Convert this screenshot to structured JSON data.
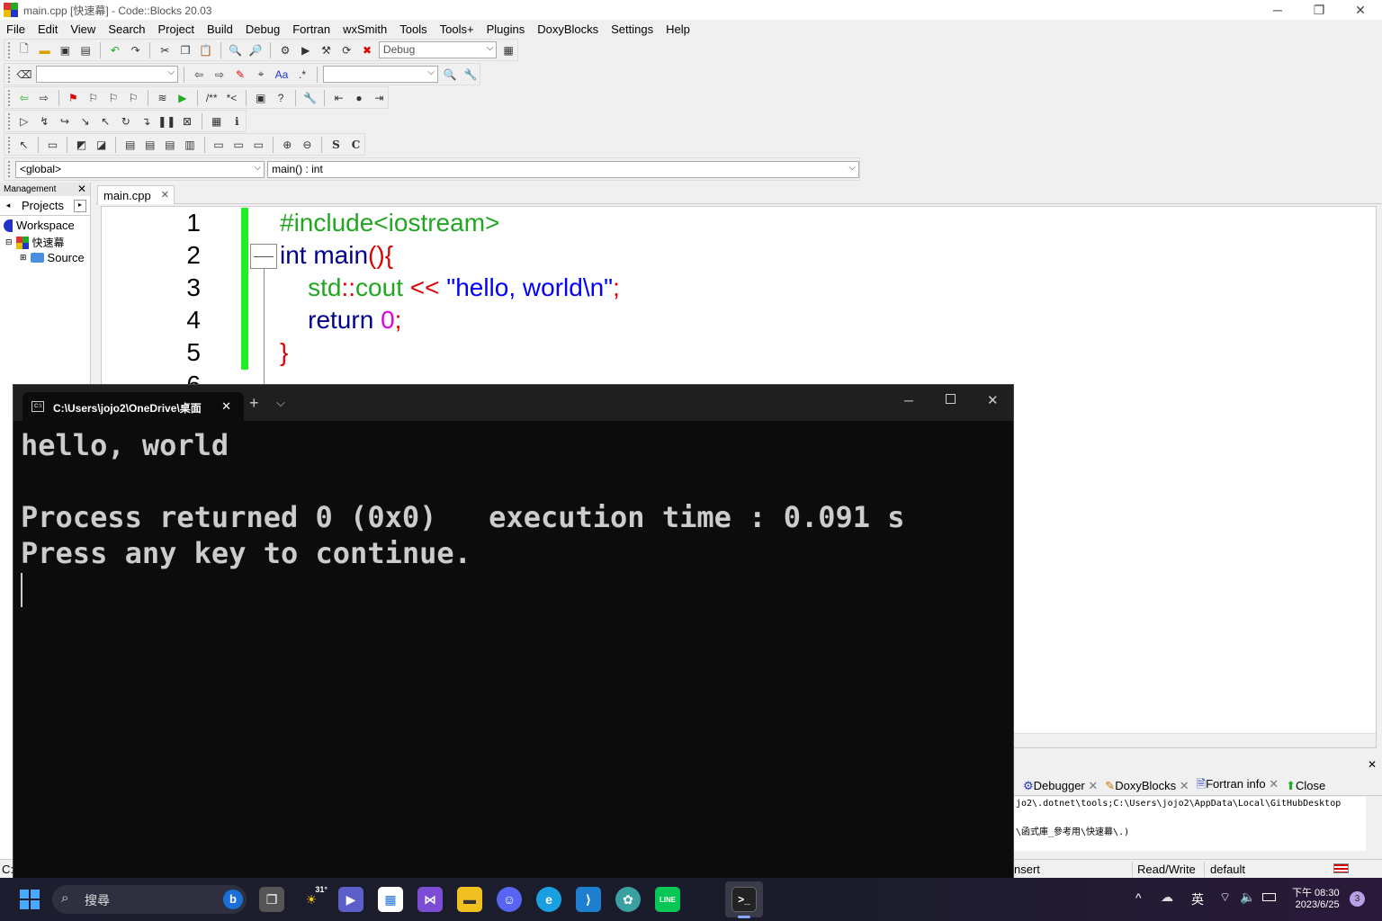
{
  "window": {
    "title": "main.cpp [快速幕] - Code::Blocks 20.03",
    "min_icon": "─",
    "max_icon": "❐",
    "close_icon": "✕"
  },
  "menu": [
    "File",
    "Edit",
    "View",
    "Search",
    "Project",
    "Build",
    "Debug",
    "Fortran",
    "wxSmith",
    "Tools",
    "Tools+",
    "Plugins",
    "DoxyBlocks",
    "Settings",
    "Help"
  ],
  "toolbar": {
    "build_target": "Debug",
    "scope": "<global>",
    "function": "main() : int"
  },
  "management": {
    "header": "Management",
    "tab": "Projects",
    "tree": [
      {
        "label": "Workspace"
      },
      {
        "label": "快速幕"
      },
      {
        "label": "Source"
      }
    ]
  },
  "editor": {
    "tab_label": "main.cpp",
    "line_numbers": [
      "1",
      "2",
      "3",
      "4",
      "5",
      "6"
    ],
    "lines": {
      "l1": "#include<iostream>",
      "l2_kw": "int",
      "l2_rest": " main",
      "l2_paren": "(){",
      "l3_indent": "    ",
      "l3_ns": "std",
      "l3_sep": "::",
      "l3_cout": "cout",
      "l3_op": " << ",
      "l3_str": "\"hello, world\\n\"",
      "l3_semi": ";",
      "l4_kw": "return",
      "l4_num": "0",
      "l4_semi": ";",
      "l5": "}"
    }
  },
  "terminal": {
    "tab_title": "C:\\Users\\jojo2\\OneDrive\\桌面",
    "new_tab": "+",
    "dropdown": "⌵",
    "output": [
      "hello, world",
      "",
      "Process returned 0 (0x0)   execution time : 0.091 s",
      "Press any key to continue."
    ]
  },
  "logs": {
    "tabs": [
      "Debugger",
      "DoxyBlocks",
      "Fortran info",
      "Close"
    ],
    "lines": [
      "jo2\\.dotnet\\tools;C:\\Users\\jojo2\\AppData\\Local\\GitHubDesktop",
      "\\函式庫_參考用\\快速幕\\.)"
    ]
  },
  "statusbar": {
    "left": "C:",
    "mode": "nsert",
    "rw": "Read/Write",
    "profile": "default"
  },
  "taskbar": {
    "search_placeholder": "搜尋",
    "weather": "31°",
    "ime": "英",
    "time": "下午 08:30",
    "date": "2023/6/25",
    "notifications": "3"
  },
  "colors": {
    "preprocessor": "#22a622",
    "keyword": "#00008b",
    "string": "#0000ff",
    "operator": "#e00000",
    "number": "#e000e0",
    "change_bar": "#22ee22"
  }
}
